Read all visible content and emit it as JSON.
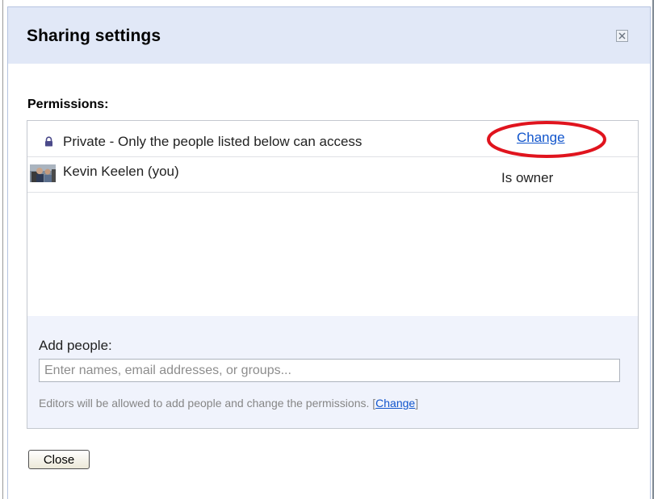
{
  "dialog": {
    "title": "Sharing settings",
    "close_icon": "close-x-icon"
  },
  "permissions": {
    "label": "Permissions:",
    "visibility": {
      "icon": "lock-icon",
      "text": "Private - Only the people listed below can access",
      "change_label": "Change"
    },
    "people": [
      {
        "name": "Kevin Keelen (you)",
        "role": "Is owner",
        "icon": "avatar"
      }
    ]
  },
  "add_people": {
    "label": "Add people:",
    "placeholder": "Enter names, email addresses, or groups...",
    "value": "",
    "note_text": "Editors will be allowed to add people and change the permissions.",
    "note_bracket_open": "[",
    "note_link": "Change",
    "note_bracket_close": "]"
  },
  "footer": {
    "close_label": "Close"
  },
  "colors": {
    "titlebar_bg": "#e1e8f7",
    "add_panel_bg": "#f0f3fc",
    "link": "#1155cc",
    "highlight": "#e0141e"
  }
}
